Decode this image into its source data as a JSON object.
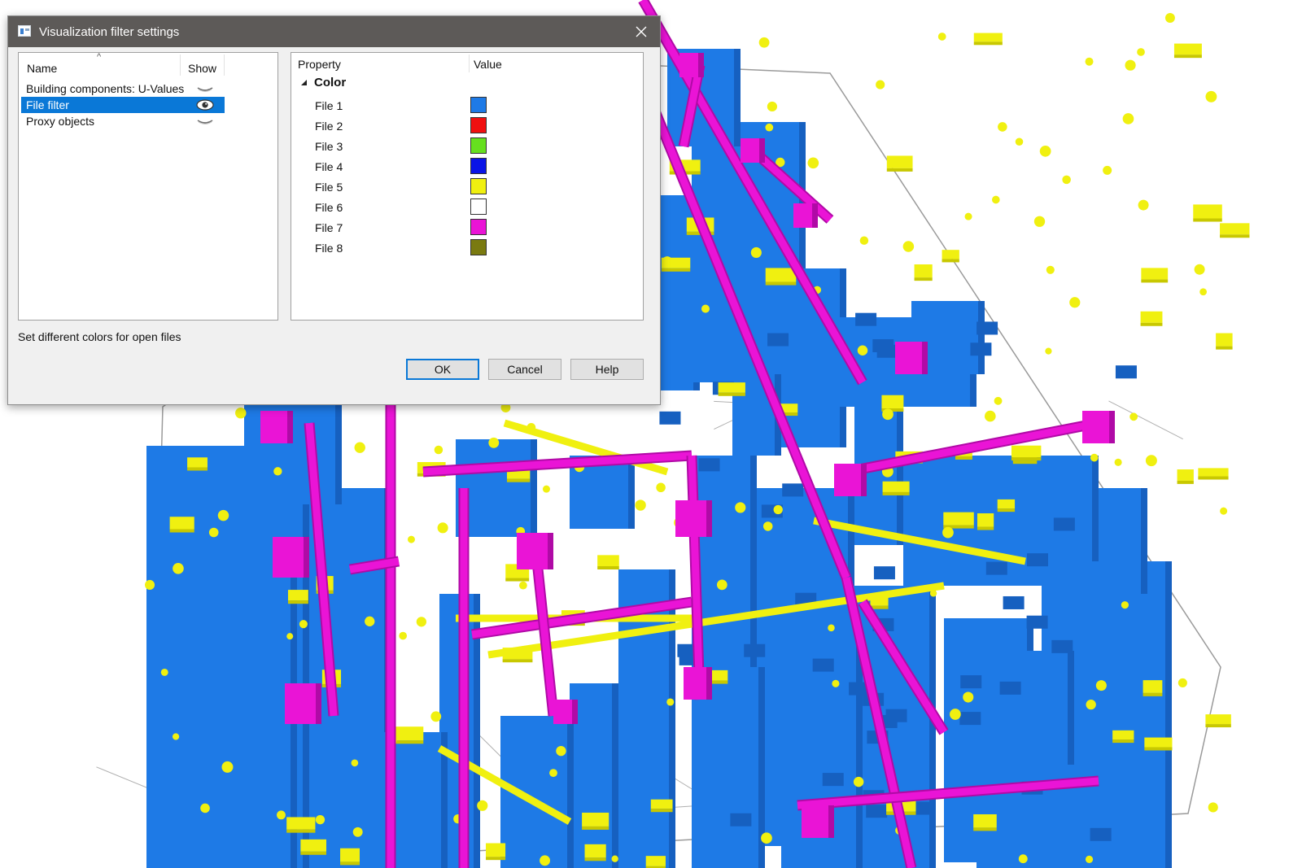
{
  "dialog": {
    "title": "Visualization filter settings",
    "filter_list": {
      "columns": {
        "name": "Name",
        "show": "Show"
      },
      "items": [
        {
          "label": "Building components: U-Values",
          "selected": false,
          "shown": false
        },
        {
          "label": "File filter",
          "selected": true,
          "shown": true
        },
        {
          "label": "Proxy objects",
          "selected": false,
          "shown": false
        }
      ]
    },
    "property_grid": {
      "columns": {
        "property": "Property",
        "value": "Value"
      },
      "category": "Color",
      "files": [
        {
          "name": "File 1",
          "color": "#1e7ae6"
        },
        {
          "name": "File 2",
          "color": "#f01010"
        },
        {
          "name": "File 3",
          "color": "#66e01e"
        },
        {
          "name": "File 4",
          "color": "#0a14e6"
        },
        {
          "name": "File 5",
          "color": "#f0f010"
        },
        {
          "name": "File 6",
          "color": "#ffffff"
        },
        {
          "name": "File 7",
          "color": "#ea14d6"
        },
        {
          "name": "File 8",
          "color": "#7a7a10"
        }
      ]
    },
    "status_text": "Set different colors for open files",
    "buttons": {
      "ok": "OK",
      "cancel": "Cancel",
      "help": "Help"
    }
  },
  "viewport": {
    "colors": {
      "components": "#1e7ae6",
      "ducts": "#ea14d6",
      "fixtures": "#f0f010",
      "background": "#ffffff"
    }
  }
}
